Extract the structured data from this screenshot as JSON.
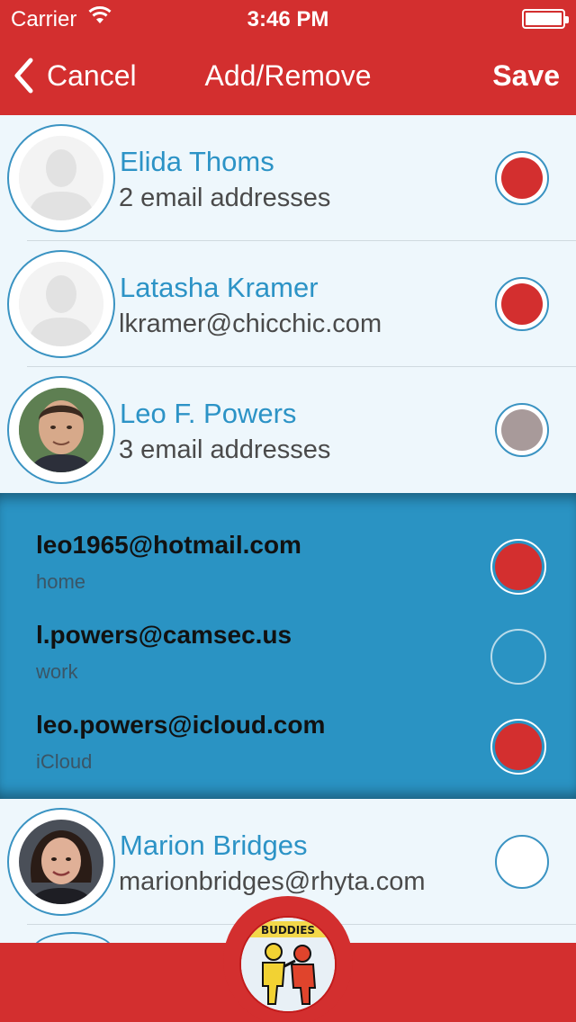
{
  "status_bar": {
    "carrier": "Carrier",
    "time": "3:46 PM"
  },
  "nav": {
    "back_label": "Cancel",
    "title": "Add/Remove",
    "save_label": "Save"
  },
  "contacts": [
    {
      "name": "Elida Thoms",
      "subtitle": "2 email addresses",
      "selection": "selected",
      "avatar": "placeholder-person-icon"
    },
    {
      "name": "Latasha Kramer",
      "subtitle": "lkramer@chicchic.com",
      "selection": "selected",
      "avatar": "placeholder-person-icon"
    },
    {
      "name": "Leo F. Powers",
      "subtitle": "3 email addresses",
      "selection": "partial",
      "avatar": "photo"
    },
    {
      "name": "Marion Bridges",
      "subtitle": "marionbridges@rhyta.com",
      "selection": "none",
      "avatar": "photo"
    }
  ],
  "expanded_emails": [
    {
      "address": "leo1965@hotmail.com",
      "label": "home",
      "selected": true
    },
    {
      "address": "l.powers@camsec.us",
      "label": "work",
      "selected": false
    },
    {
      "address": "leo.powers@icloud.com",
      "label": "iCloud",
      "selected": true
    }
  ],
  "footer": {
    "logo": "best-buddies-logo"
  },
  "colors": {
    "brand_red": "#d32f2f",
    "accent_blue": "#2c93c6",
    "expanded_bg": "#2a93c3",
    "partial_gray": "#a89a9a"
  }
}
